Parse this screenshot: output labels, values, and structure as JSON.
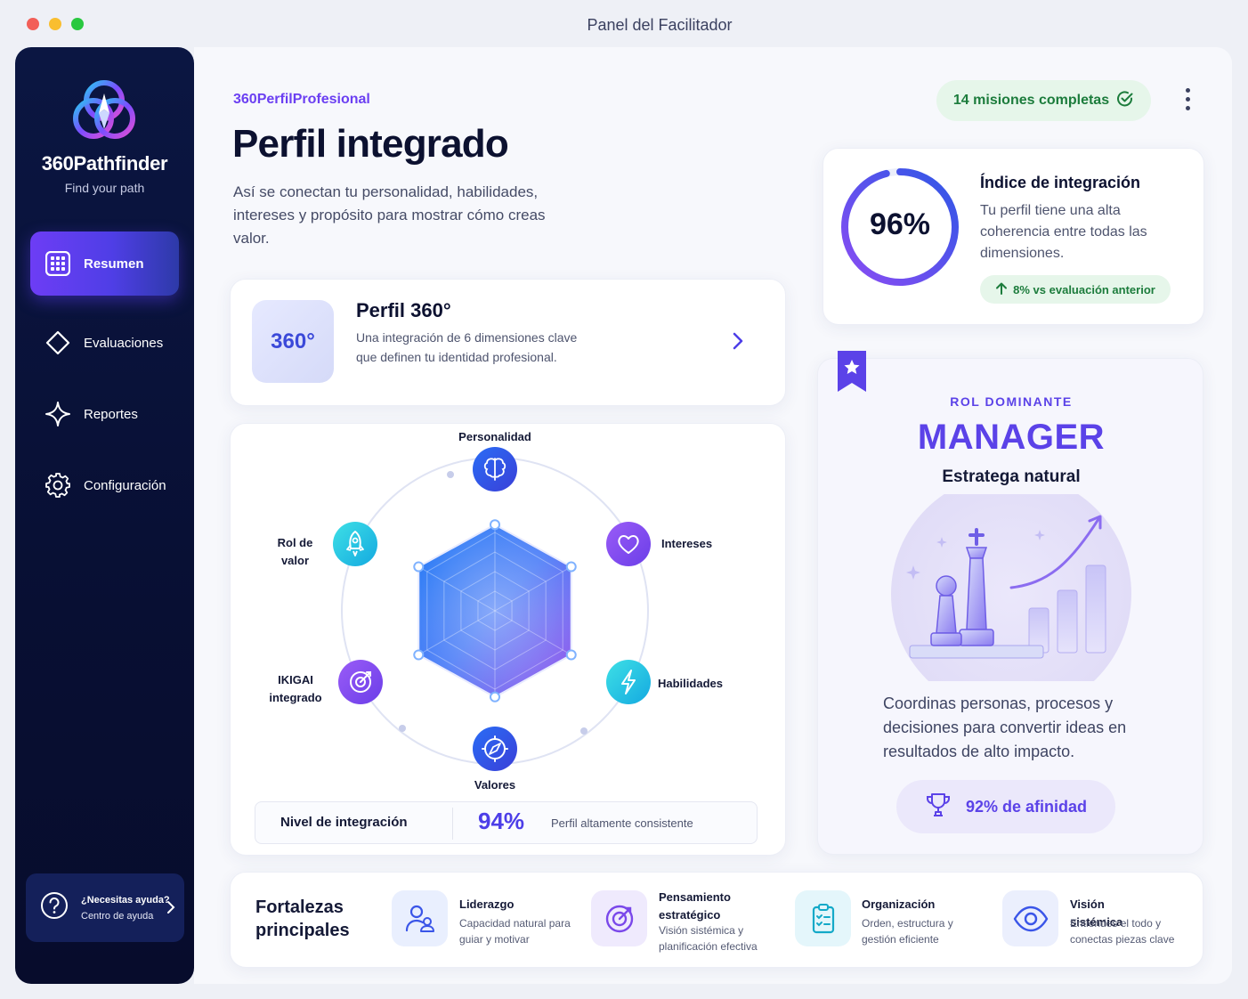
{
  "window": {
    "title": "Panel del Facilitador"
  },
  "sidebar": {
    "brand": "360Pathfinder",
    "tagline": "Find your path",
    "items": [
      {
        "label": "Resumen",
        "icon": "grid-icon",
        "active": true
      },
      {
        "label": "Evaluaciones",
        "icon": "diamond-icon",
        "active": false
      },
      {
        "label": "Reportes",
        "icon": "sparkle-icon",
        "active": false
      },
      {
        "label": "Configuración",
        "icon": "gear-icon",
        "active": false
      }
    ],
    "help": {
      "title": "¿Necesitas ayuda?",
      "subtitle": "Centro de ayuda"
    }
  },
  "header": {
    "breadcrumb": "360PerfilProfesional",
    "title": "Perfil integrado",
    "description": "Así se conectan tu personalidad, habilidades, intereses y propósito para mostrar cómo creas valor.",
    "missions_badge": "14 misiones completas"
  },
  "profile360": {
    "badge": "360°",
    "title": "Perfil 360°",
    "description": "Una integración de 6 dimensiones clave que definen tu identidad profesional."
  },
  "radar": {
    "dimensions": [
      {
        "label": "Personalidad",
        "icon": "brain-icon",
        "value": 0.88
      },
      {
        "label": "Intereses",
        "icon": "heart-icon",
        "value": 0.9
      },
      {
        "label": "Habilidades",
        "icon": "lightning-icon",
        "value": 0.9
      },
      {
        "label": "Valores",
        "icon": "compass-icon",
        "value": 0.88
      },
      {
        "label": "IKIGAI integrado",
        "icon": "target-icon",
        "value": 0.9
      },
      {
        "label": "Rol de valor",
        "icon": "rocket-icon",
        "value": 0.9
      }
    ],
    "level_label": "Nivel de integración",
    "level_value": "94%",
    "level_desc": "Perfil altamente consistente"
  },
  "integration_index": {
    "title": "Índice de integración",
    "value": "96%",
    "progress": 0.96,
    "description": "Tu perfil tiene una alta coherencia entre todas las dimensiones.",
    "delta": "8% vs evaluación anterior"
  },
  "dominant_role": {
    "kicker": "ROL DOMINANTE",
    "name": "MANAGER",
    "subtitle": "Estratega natural",
    "description": "Coordinas personas, procesos y decisiones para convertir ideas en resultados de alto impacto.",
    "affinity": "92% de afinidad"
  },
  "strengths": {
    "title": "Fortalezas principales",
    "items": [
      {
        "name": "Liderazgo",
        "desc": "Capacidad natural para guiar y motivar",
        "icon": "people-icon"
      },
      {
        "name": "Pensamiento estratégico",
        "desc": "Visión sistémica y planificación efectiva",
        "icon": "target-icon"
      },
      {
        "name": "Organización",
        "desc": "Orden, estructura y gestión eficiente",
        "icon": "clipboard-icon"
      },
      {
        "name": "Visión sistémica",
        "desc": "Entiendes el todo y conectas piezas clave",
        "icon": "eye-icon"
      }
    ]
  },
  "colors": {
    "accent": "#5b42e8",
    "sidebar_bg": "#0b1642",
    "success": "#1c7c3c",
    "success_bg": "#e6f6ea"
  }
}
